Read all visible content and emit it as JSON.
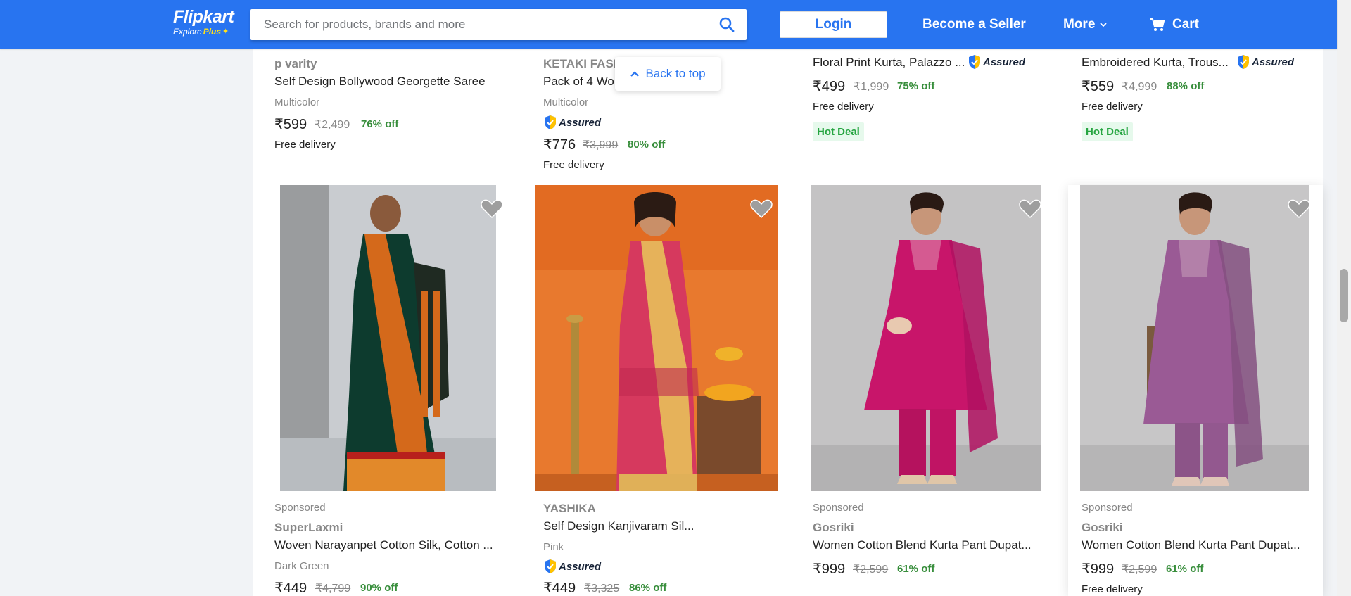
{
  "header": {
    "logo_text": "Flipkart",
    "logo_sub": "Explore",
    "logo_plus": "Plus",
    "search_placeholder": "Search for products, brands and more",
    "login_label": "Login",
    "seller_label": "Become a Seller",
    "more_label": "More",
    "cart_label": "Cart",
    "bg_color": "#2874f0"
  },
  "back_to_top": "Back to top",
  "top_row": [
    {
      "brand": "p varity",
      "title": "Self Design Bollywood Georgette Saree",
      "color": "Multicolor",
      "price": "₹599",
      "mrp": "₹2,499",
      "off": "76% off",
      "delivery": "Free delivery"
    },
    {
      "brand": "KETAKI FASH",
      "title": "Pack of 4 Wo",
      "color": "Multicolor",
      "assured": "Assured",
      "price": "₹776",
      "mrp": "₹3,999",
      "off": "80% off",
      "delivery": "Free delivery"
    },
    {
      "title": "Floral Print Kurta, Palazzo ...",
      "assured": "Assured",
      "price": "₹499",
      "mrp": "₹1,999",
      "off": "75% off",
      "delivery": "Free delivery",
      "badge": "Hot Deal"
    },
    {
      "title": "Embroidered Kurta, Trous...",
      "assured": "Assured",
      "price": "₹559",
      "mrp": "₹4,999",
      "off": "88% off",
      "delivery": "Free delivery",
      "badge": "Hot Deal"
    }
  ],
  "bottom_row": [
    {
      "sponsored": "Sponsored",
      "brand": "SuperLaxmi",
      "title": "Woven Narayanpet Cotton Silk, Cotton ...",
      "color": "Dark Green",
      "price": "₹449",
      "mrp": "₹4,799",
      "off": "90% off",
      "image": "green-orange-saree"
    },
    {
      "brand": "YASHIKA",
      "title": "Self Design Kanjivaram Sil...",
      "color": "Pink",
      "assured": "Assured",
      "price": "₹449",
      "mrp": "₹3,325",
      "off": "86% off",
      "image": "pink-saree-orange-bg"
    },
    {
      "sponsored": "Sponsored",
      "brand": "Gosriki",
      "title": "Women Cotton Blend Kurta Pant Dupat...",
      "price": "₹999",
      "mrp": "₹2,599",
      "off": "61% off",
      "image": "magenta-kurta-set"
    },
    {
      "sponsored": "Sponsored",
      "brand": "Gosriki",
      "title": "Women Cotton Blend Kurta Pant Dupat...",
      "price": "₹999",
      "mrp": "₹2,599",
      "off": "61% off",
      "delivery": "Free delivery",
      "image": "purple-kurta-set"
    }
  ]
}
